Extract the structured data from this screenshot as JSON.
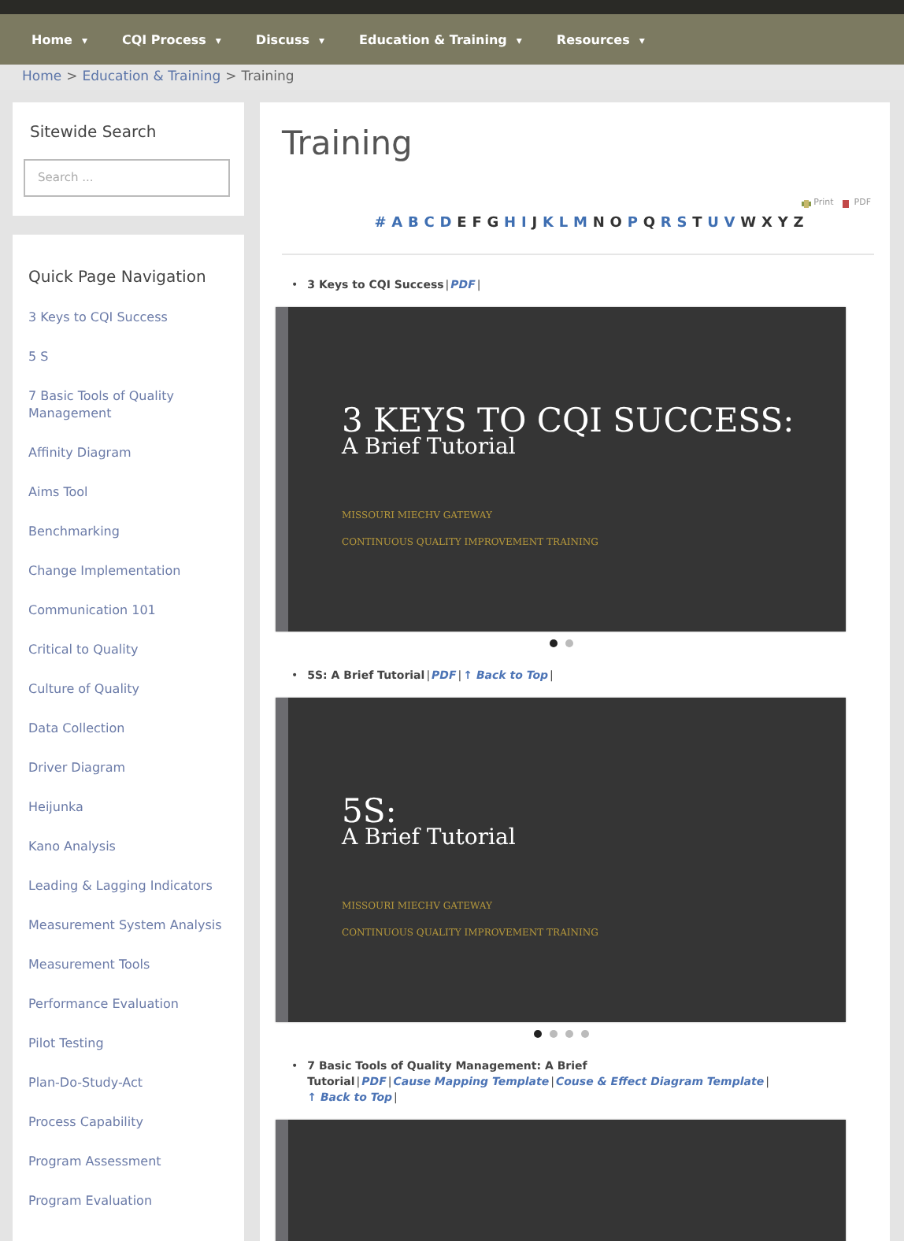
{
  "nav": [
    {
      "label": "Home",
      "caret": "▾"
    },
    {
      "label": "CQI Process",
      "caret": "▾"
    },
    {
      "label": "Discuss",
      "caret": "▾"
    },
    {
      "label": "Education & Training",
      "caret": "▾"
    },
    {
      "label": "Resources",
      "caret": "▾"
    }
  ],
  "breadcrumb": [
    {
      "kind": "link",
      "text": "Home"
    },
    {
      "kind": "sep",
      "text": ">"
    },
    {
      "kind": "link",
      "text": "Education & Training"
    },
    {
      "kind": "sep",
      "text": ">"
    },
    {
      "kind": "current",
      "text": "Training"
    }
  ],
  "search": {
    "title": "Sitewide Search",
    "placeholder": "Search ..."
  },
  "quick_nav": {
    "title": "Quick Page Navigation",
    "items": [
      "3 Keys to CQI Success",
      "5 S",
      "7 Basic Tools of Quality Management",
      "Affinity Diagram",
      "Aims Tool",
      "Benchmarking",
      "Change Implementation",
      "Communication 101",
      "Critical to Quality",
      "Culture of Quality",
      "Data Collection",
      "Driver Diagram",
      "Heijunka",
      "Kano Analysis",
      "Leading & Lagging Indicators",
      "Measurement System Analysis",
      "Measurement Tools",
      "Performance Evaluation",
      "Pilot Testing",
      "Plan-Do-Study-Act",
      "Process Capability",
      "Program Assessment",
      "Program Evaluation"
    ]
  },
  "page_title": "Training",
  "tools": [
    {
      "kind": "print",
      "label": "Print"
    },
    {
      "kind": "pdf",
      "label": "PDF"
    }
  ],
  "letters": [
    {
      "label": "#",
      "linked": true
    },
    {
      "label": "A",
      "linked": true
    },
    {
      "label": "B",
      "linked": true
    },
    {
      "label": "C",
      "linked": true
    },
    {
      "label": "D",
      "linked": true
    },
    {
      "label": "E",
      "linked": false
    },
    {
      "label": "F",
      "linked": false
    },
    {
      "label": "G",
      "linked": false
    },
    {
      "label": "H",
      "linked": true
    },
    {
      "label": "I",
      "linked": true
    },
    {
      "label": "J",
      "linked": false
    },
    {
      "label": "K",
      "linked": true
    },
    {
      "label": "L",
      "linked": true
    },
    {
      "label": "M",
      "linked": true
    },
    {
      "label": "N",
      "linked": false
    },
    {
      "label": "O",
      "linked": false
    },
    {
      "label": "P",
      "linked": true
    },
    {
      "label": "Q",
      "linked": false
    },
    {
      "label": "R",
      "linked": true
    },
    {
      "label": "S",
      "linked": true
    },
    {
      "label": "T",
      "linked": false
    },
    {
      "label": "U",
      "linked": true
    },
    {
      "label": "V",
      "linked": true
    },
    {
      "label": "W",
      "linked": false
    },
    {
      "label": "X",
      "linked": false
    },
    {
      "label": "Y",
      "linked": false
    },
    {
      "label": "Z",
      "linked": false
    }
  ],
  "entries": [
    {
      "bullet": "•",
      "segments": [
        {
          "kind": "title",
          "text": "3 Keys to CQI Success"
        },
        {
          "kind": "sep",
          "text": "|"
        },
        {
          "kind": "link",
          "text": "PDF"
        },
        {
          "kind": "sep",
          "text": "|"
        }
      ],
      "slide": {
        "kind": "titled",
        "title": "3 KEYS TO CQI SUCCESS:",
        "subtitle": "A Brief Tutorial",
        "lines": [
          "MISSOURI MIECHV GATEWAY",
          "CONTINUOUS QUALITY IMPROVEMENT TRAINING"
        ],
        "dots": [
          {
            "selected": true
          },
          {
            "selected": false
          }
        ]
      }
    },
    {
      "bullet": "•",
      "segments": [
        {
          "kind": "title",
          "text": "5S: A Brief Tutorial"
        },
        {
          "kind": "sep",
          "text": "|"
        },
        {
          "kind": "link",
          "text": "PDF"
        },
        {
          "kind": "sep",
          "text": "|"
        },
        {
          "kind": "link",
          "text": "↑ Back to Top"
        },
        {
          "kind": "sep",
          "text": "|"
        }
      ],
      "slide": {
        "kind": "titled",
        "title": "5S:",
        "subtitle": "A Brief Tutorial",
        "lines": [
          "MISSOURI MIECHV GATEWAY",
          "CONTINUOUS QUALITY IMPROVEMENT TRAINING"
        ],
        "dots": [
          {
            "selected": true
          },
          {
            "selected": false
          },
          {
            "selected": false
          },
          {
            "selected": false
          }
        ]
      }
    },
    {
      "bullet": "•",
      "segments": [
        {
          "kind": "title",
          "text": "7 Basic Tools of Quality Management: A Brief Tutorial"
        },
        {
          "kind": "sep",
          "text": "|"
        },
        {
          "kind": "link",
          "text": "PDF"
        },
        {
          "kind": "sep",
          "text": "|"
        },
        {
          "kind": "link",
          "text": "Cause Mapping Template"
        },
        {
          "kind": "sep",
          "text": "|"
        },
        {
          "kind": "link",
          "text": "Couse & Effect Diagram Template"
        },
        {
          "kind": "sep",
          "text": "|"
        },
        {
          "kind": "link",
          "text": "↑ Back to Top"
        },
        {
          "kind": "sep",
          "text": "|"
        }
      ],
      "slide": {
        "kind": "blank"
      }
    }
  ]
}
